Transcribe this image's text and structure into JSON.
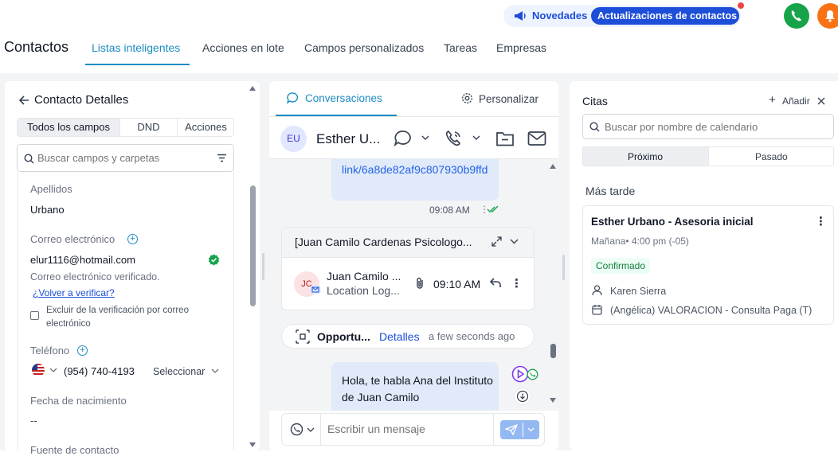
{
  "topbar": {
    "news_label": "Novedades",
    "updates_label": "Actualizaciones de contactos",
    "colors": {
      "news_text": "#1d4ed8",
      "phone": "#16a34a",
      "bell": "#f97316",
      "dot": "#ef4444"
    }
  },
  "nav": {
    "page_title": "Contactos",
    "tabs": [
      {
        "label": "Listas inteligentes",
        "active": true
      },
      {
        "label": "Acciones en lote"
      },
      {
        "label": "Campos personalizados"
      },
      {
        "label": "Tareas"
      },
      {
        "label": "Empresas"
      }
    ]
  },
  "details": {
    "title": "Contacto Detalles",
    "tabs": [
      {
        "label": "Todos los campos",
        "active": true
      },
      {
        "label": "DND"
      },
      {
        "label": "Acciones"
      }
    ],
    "search_placeholder": "Buscar campos y carpetas",
    "fields": {
      "lastname_label": "Apellidos",
      "lastname_value": "Urbano",
      "email_label": "Correo electrónico",
      "email_value": "elur1116@hotmail.com",
      "email_verified_text": "Correo electrónico verificado.",
      "reverify_link": "¿Volver a verificar?",
      "exclude_label": "Excluir de la verificación por correo electrónico",
      "phone_label": "Teléfono",
      "phone_value": "(954) 740-4193",
      "phone_select": "Seleccionar",
      "birth_label": "Fecha de nacimiento",
      "birth_value": "--",
      "source_label": "Fuente de contacto"
    }
  },
  "conversation": {
    "tabs": [
      {
        "label": "Conversaciones",
        "active": true
      },
      {
        "label": "Personalizar"
      }
    ],
    "contact_initials": "EU",
    "contact_name": "Esther U...",
    "message_link": "link/6a8de82af9c807930b9ffd",
    "message_time": "09:08 AM",
    "email": {
      "subject": "[Juan Camilo Cardenas Psicologo...",
      "sender_initials": "JC",
      "sender": "Juan Camilo ...",
      "preview": "Location Log...",
      "time": "09:10 AM"
    },
    "opportunity": {
      "title": "Opportu...",
      "link": "Detalles",
      "time": "a few seconds ago"
    },
    "outgoing_text": "Hola, te habla Ana del Instituto de Juan Camilo",
    "compose_placeholder": "Escribir un mensaje"
  },
  "appointments": {
    "title": "Citas",
    "add_label": "Añadir",
    "search_placeholder": "Buscar por nombre de calendario",
    "segments": [
      {
        "label": "Próximo",
        "active": true
      },
      {
        "label": "Pasado"
      }
    ],
    "group_label": "Más tarde",
    "item": {
      "title": "Esther Urbano - Asesoria inicial",
      "when": "Mañana• 4:00 pm (-05)",
      "status": "Confirmado",
      "user": "Karen Sierra",
      "calendar": "(Angélica) VALORACION - Consulta Paga (T)"
    }
  }
}
